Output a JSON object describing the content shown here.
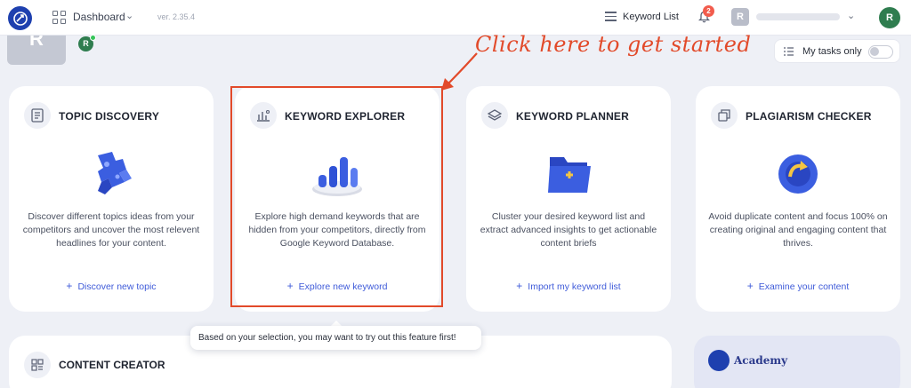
{
  "header": {
    "dashboard_label": "Dashboard",
    "version": "ver. 2.35.4",
    "keyword_list_label": "Keyword List",
    "notification_count": "2",
    "user_initial": "R",
    "avatar_initial": "R"
  },
  "profile": {
    "big_initial": "R",
    "small_initial": "R"
  },
  "annotation": "Click here to get started",
  "my_tasks": {
    "label": "My tasks only",
    "enabled": false
  },
  "cards": [
    {
      "title": "TOPIC DISCOVERY",
      "description": "Discover different topics ideas from your competitors and uncover the most relevent headlines for your content.",
      "action": "Discover new topic"
    },
    {
      "title": "KEYWORD EXPLORER",
      "description": "Explore high demand keywords that are hidden from your competitors, directly from Google Keyword Database.",
      "action": "Explore new keyword"
    },
    {
      "title": "KEYWORD PLANNER",
      "description": "Cluster your desired keyword list and extract advanced insights to get actionable content briefs",
      "action": "Import my keyword list"
    },
    {
      "title": "PLAGIARISM CHECKER",
      "description": "Avoid duplicate content and focus 100% on creating original and engaging content that thrives.",
      "action": "Examine your content"
    }
  ],
  "bottom": {
    "content_creator_title": "CONTENT CREATOR",
    "academy_label": "Academy"
  },
  "tooltip": "Based on your selection, you may want to try out this feature first!",
  "colors": {
    "accent": "#3f5bd9",
    "annotation": "#e24a2a",
    "brand": "#1e40af"
  }
}
